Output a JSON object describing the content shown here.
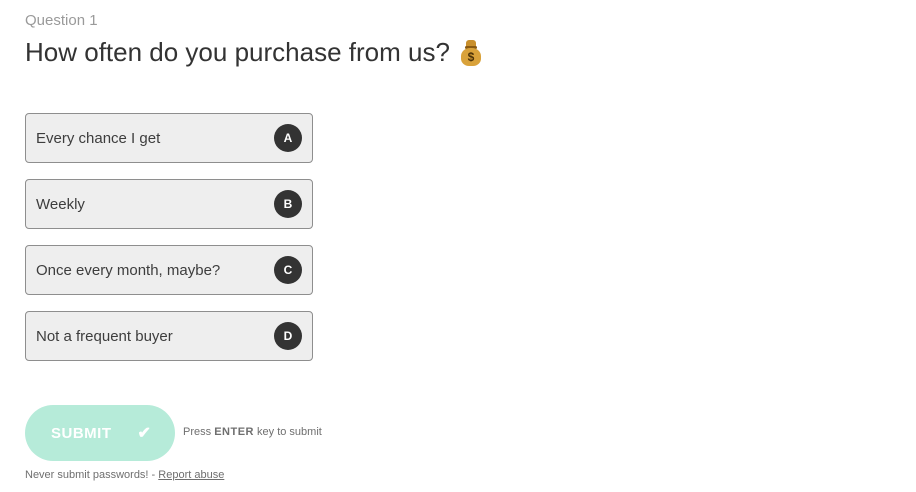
{
  "question": {
    "number_label": "Question 1",
    "title": "How often do you purchase from us?",
    "emoji_icon": "money-bag-icon",
    "emoji_symbol": "$"
  },
  "choices": [
    {
      "label": "Every chance I get",
      "key": "A"
    },
    {
      "label": "Weekly",
      "key": "B"
    },
    {
      "label": "Once every month, maybe?",
      "key": "C"
    },
    {
      "label": "Not a frequent buyer",
      "key": "D"
    }
  ],
  "submit": {
    "label": "SUBMIT",
    "check_icon": "✔",
    "hint_prefix": "Press",
    "hint_key": "ENTER",
    "hint_suffix": "key to submit"
  },
  "footer": {
    "warning": "Never submit passwords! -",
    "report_link": "Report abuse"
  },
  "colors": {
    "submit_bg": "#b6ebd9",
    "choice_bg": "#eeeeee",
    "key_badge_bg": "#333333"
  }
}
